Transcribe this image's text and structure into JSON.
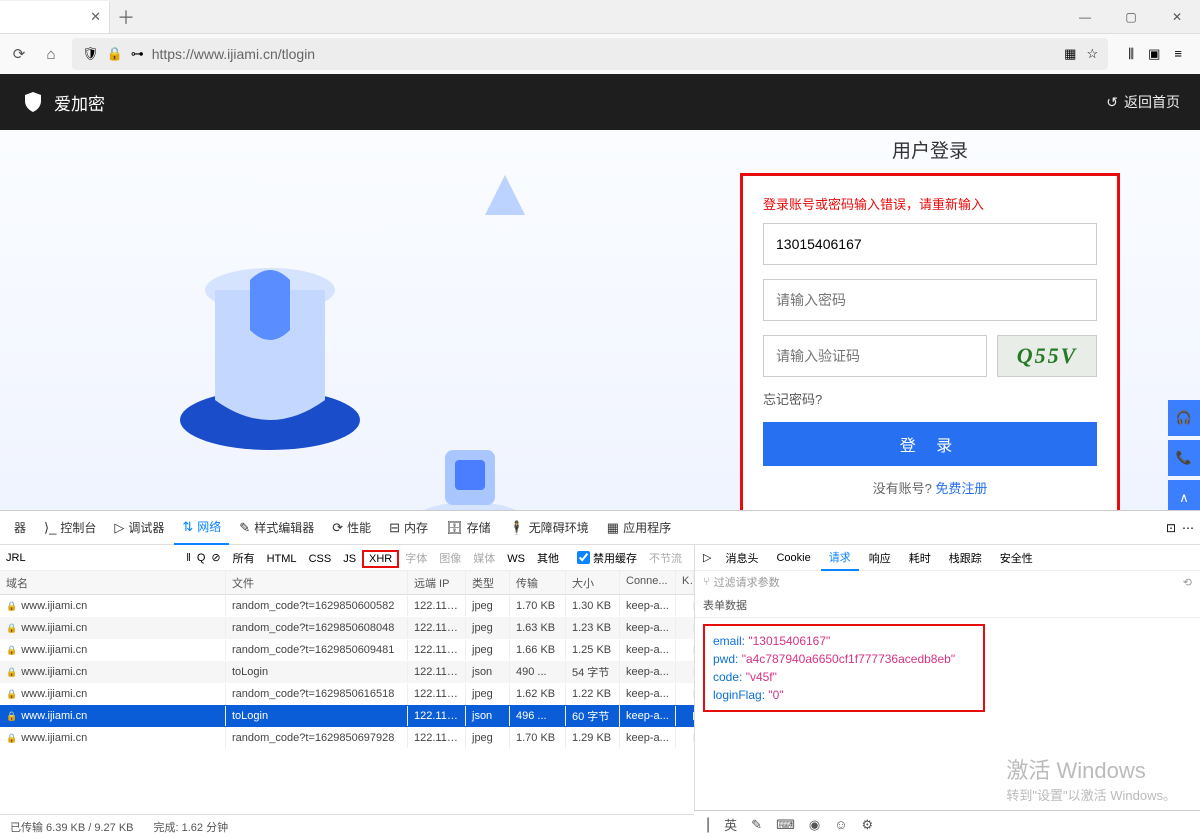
{
  "browser": {
    "url": "https://www.ijiami.cn/tlogin",
    "window": {
      "min": "—",
      "max": "▢",
      "close": "✕"
    }
  },
  "header": {
    "brand": "爱加密",
    "return_home": "返回首页"
  },
  "login": {
    "title": "用户登录",
    "error": "登录账号或密码输入错误，请重新输入",
    "username_value": "13015406167",
    "password_placeholder": "请输入密码",
    "captcha_placeholder": "请输入验证码",
    "captcha_text": "Q55V",
    "forgot": "忘记密码?",
    "login_button": "登 录",
    "no_account": "没有账号? ",
    "register": "免费注册"
  },
  "devtools": {
    "tabs": [
      "器",
      "控制台",
      "调试器",
      "网络",
      "样式编辑器",
      "性能",
      "内存",
      "存储",
      "无障碍环境",
      "应用程序"
    ],
    "active_tab": "网络",
    "filter_label": "JRL",
    "filter_chips": [
      "所有",
      "HTML",
      "CSS",
      "JS",
      "XHR",
      "字体",
      "图像",
      "媒体",
      "WS",
      "其他"
    ],
    "disable_cache": "禁用缓存",
    "throttle": "不节流",
    "columns": [
      "域名",
      "文件",
      "远端 IP",
      "类型",
      "传输",
      "大小",
      "Conne...",
      "Ke"
    ],
    "rows": [
      {
        "domain": "www.ijiami.cn",
        "file": "random_code?t=1629850600582",
        "ip": "122.114...",
        "type": "jpeg",
        "tx": "1.70 KB",
        "size": "1.30 KB",
        "conn": "keep-a..."
      },
      {
        "domain": "www.ijiami.cn",
        "file": "random_code?t=1629850608048",
        "ip": "122.114...",
        "type": "jpeg",
        "tx": "1.63 KB",
        "size": "1.23 KB",
        "conn": "keep-a..."
      },
      {
        "domain": "www.ijiami.cn",
        "file": "random_code?t=1629850609481",
        "ip": "122.114...",
        "type": "jpeg",
        "tx": "1.66 KB",
        "size": "1.25 KB",
        "conn": "keep-a..."
      },
      {
        "domain": "www.ijiami.cn",
        "file": "toLogin",
        "ip": "122.114...",
        "type": "json",
        "tx": "490 ...",
        "size": "54 字节",
        "conn": "keep-a..."
      },
      {
        "domain": "www.ijiami.cn",
        "file": "random_code?t=1629850616518",
        "ip": "122.114...",
        "type": "jpeg",
        "tx": "1.62 KB",
        "size": "1.22 KB",
        "conn": "keep-a..."
      },
      {
        "domain": "www.ijiami.cn",
        "file": "toLogin",
        "ip": "122.114...",
        "type": "json",
        "tx": "496 ...",
        "size": "60 字节",
        "conn": "keep-a...",
        "selected": true
      },
      {
        "domain": "www.ijiami.cn",
        "file": "random_code?t=1629850697928",
        "ip": "122.114...",
        "type": "jpeg",
        "tx": "1.70 KB",
        "size": "1.29 KB",
        "conn": "keep-a..."
      }
    ],
    "status": {
      "transferred": "已传输 6.39 KB / 9.27 KB",
      "finish": "完成:  1.62 分钟"
    },
    "detail_tabs": [
      "消息头",
      "Cookie",
      "请求",
      "响应",
      "耗时",
      "栈跟踪",
      "安全性"
    ],
    "detail_active": "请求",
    "filter_params": "过滤请求参数",
    "form_data_title": "表单数据",
    "form_data": [
      {
        "k": "email:",
        "v": "\"13015406167\""
      },
      {
        "k": "pwd:",
        "v": "\"a4c787940a6650cf1f777736acedb8eb\""
      },
      {
        "k": "code:",
        "v": "\"v45f\""
      },
      {
        "k": "loginFlag:",
        "v": "\"0\""
      }
    ]
  },
  "watermark": {
    "line1": "激活 Windows",
    "line2": "转到\"设置\"以激活 Windows。"
  },
  "ime": {
    "items": [
      "英",
      "✎",
      "⌨",
      "◉",
      "☺",
      "⚙"
    ]
  }
}
